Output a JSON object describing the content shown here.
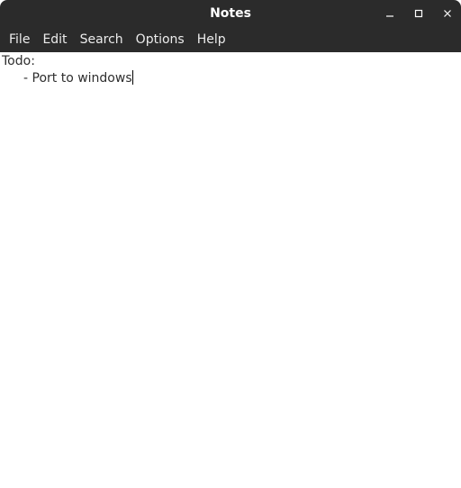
{
  "window": {
    "title": "Notes",
    "titlebar_color": "#2b2b2b",
    "controls": [
      "minimize-icon",
      "maximize-icon",
      "close-icon"
    ]
  },
  "menubar": {
    "items": [
      "File",
      "Edit",
      "Search",
      "Options",
      "Help"
    ]
  },
  "editor": {
    "lines": [
      "Todo:",
      "- Port to windows"
    ]
  }
}
